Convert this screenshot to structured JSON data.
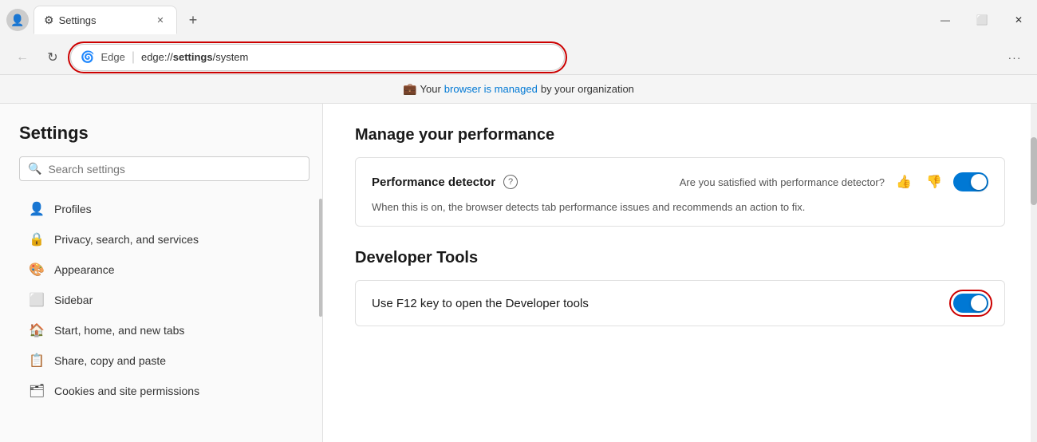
{
  "window": {
    "title": "Settings",
    "tab_icon": "⚙",
    "new_tab_icon": "+",
    "minimize": "—",
    "maximize": "⬜",
    "close": "✕"
  },
  "nav": {
    "back_icon": "←",
    "reload_icon": "↻",
    "edge_label": "Edge",
    "address": "edge://settings/system",
    "address_bold": "settings",
    "more_icon": "···"
  },
  "managed_bar": {
    "icon": "💼",
    "text_before": "Your",
    "link": "browser is managed",
    "text_after": "by your organization"
  },
  "sidebar": {
    "title": "Settings",
    "search_placeholder": "Search settings",
    "items": [
      {
        "label": "Profiles",
        "icon": "👤"
      },
      {
        "label": "Privacy, search, and services",
        "icon": "🔒"
      },
      {
        "label": "Appearance",
        "icon": "🎨"
      },
      {
        "label": "Sidebar",
        "icon": "⬜"
      },
      {
        "label": "Start, home, and new tabs",
        "icon": "🏠"
      },
      {
        "label": "Share, copy and paste",
        "icon": "📋"
      },
      {
        "label": "Cookies and site permissions",
        "icon": "🗂"
      }
    ]
  },
  "content": {
    "section1": {
      "title": "Manage your performance",
      "card": {
        "label": "Performance detector",
        "question": "?",
        "feedback_text": "Are you satisfied with performance detector?",
        "thumbup": "👍",
        "thumbdown": "👎",
        "description": "When this is on, the browser detects tab performance issues and recommends an action to fix.",
        "toggle_on": true
      }
    },
    "section2": {
      "title": "Developer Tools",
      "card": {
        "label": "Use F12 key to open the Developer tools",
        "toggle_on": true
      }
    }
  }
}
